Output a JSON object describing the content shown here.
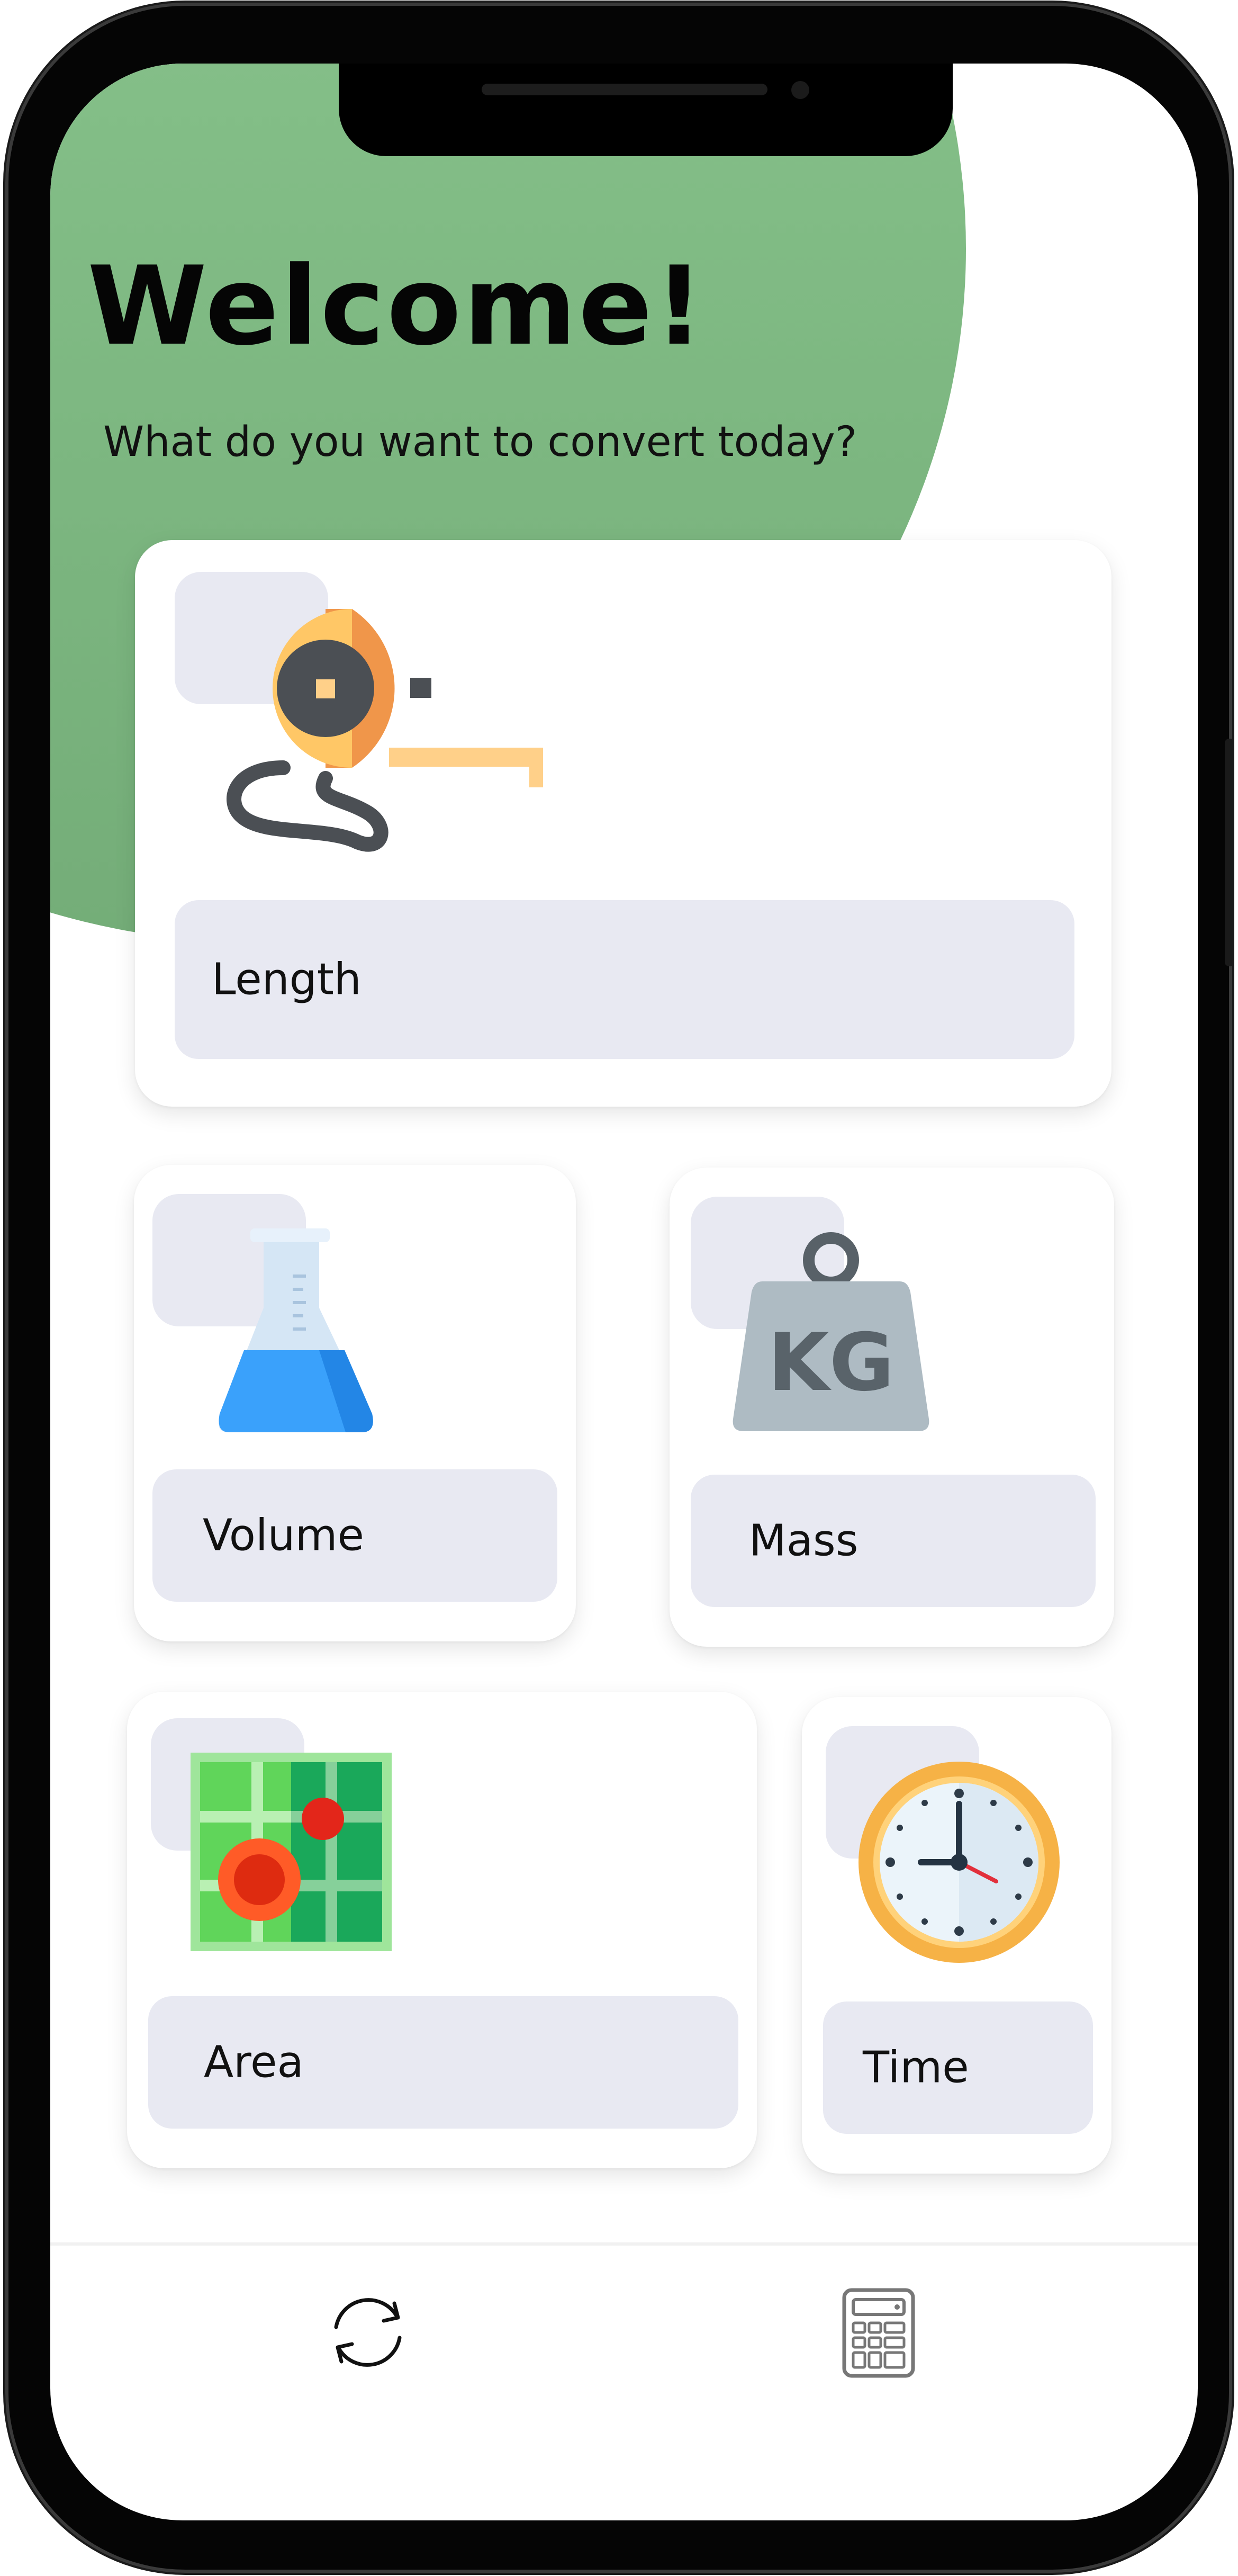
{
  "header": {
    "title": "Welcome!",
    "subtitle": "What do you want to convert today?"
  },
  "categories": [
    {
      "label": "Length",
      "icon": "tape-measure-icon"
    },
    {
      "label": "Volume",
      "icon": "flask-icon"
    },
    {
      "label": "Mass",
      "icon": "kg-weight-icon"
    },
    {
      "label": "Area",
      "icon": "map-icon"
    },
    {
      "label": "Time",
      "icon": "clock-icon"
    }
  ],
  "bottom_nav": [
    {
      "icon": "convert-refresh-icon"
    },
    {
      "icon": "calculator-icon"
    }
  ],
  "colors": {
    "header_circle": "#84bf88",
    "card_background": "#ffffff",
    "label_background": "#e8e9f2",
    "text": "#111111"
  }
}
